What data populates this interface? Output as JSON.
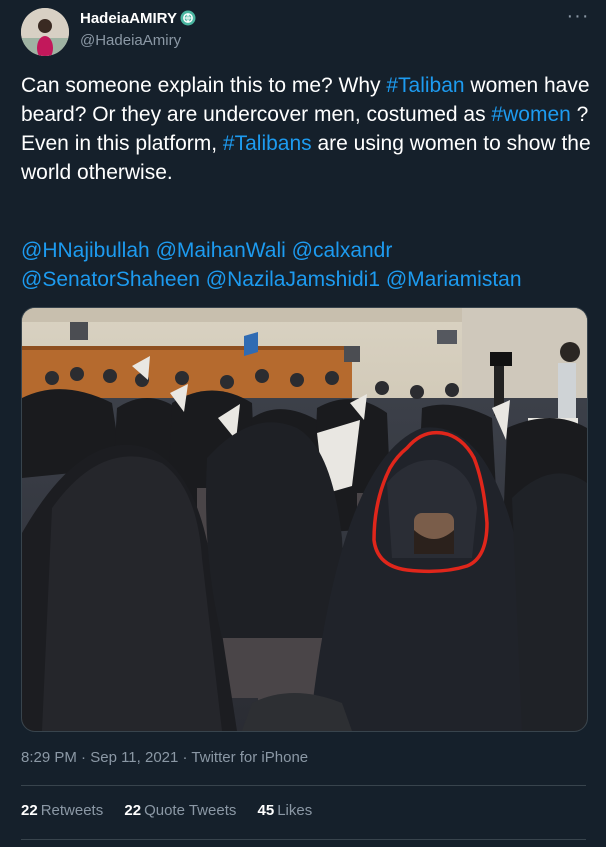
{
  "author": {
    "display_name": "HadeiaAMIRY",
    "handle": "@HadeiaAmiry",
    "verified_icon": "verified-badge-icon",
    "avatar_icon": "profile-avatar"
  },
  "more_icon": "more-options-icon",
  "tweet": {
    "line1_a": "Can someone explain this to me? Why ",
    "hashtag_taliban": "#Taliban",
    "line1_b": " women have beard? Or they are undercover men, costumed as ",
    "hashtag_women": "#women",
    "line1_c": " ?",
    "line2_a": "Even in this platform, ",
    "hashtag_talibans": "#Talibans",
    "line2_b": " are using women to show the world otherwise.",
    "mentions": [
      "@HNajibullah",
      "@MaihanWali",
      "@calxandr",
      "@SenatorShaheen",
      "@NazilaJamshidi1",
      "@Mariamistan"
    ]
  },
  "meta": {
    "time": "8:29 PM",
    "separator": " · ",
    "date": "Sep 11, 2021",
    "source": "Twitter for iPhone"
  },
  "stats": {
    "retweets_count": "22",
    "retweets_label": "Retweets",
    "quotes_count": "22",
    "quotes_label": "Quote Tweets",
    "likes_count": "45",
    "likes_label": "Likes"
  },
  "colors": {
    "background": "#15202b",
    "link": "#1d9bf0",
    "secondary_text": "#8b98a5",
    "divider": "#38444d",
    "highlight_circle": "#e0261b"
  }
}
